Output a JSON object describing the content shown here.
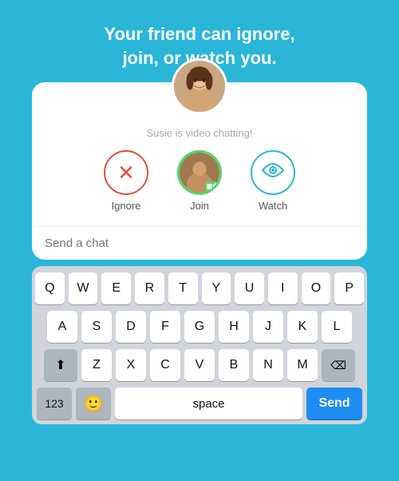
{
  "header": {
    "title": "Your friend can ignore,\njoin, or watch you."
  },
  "card": {
    "status_text": "Susie is video chatting!",
    "actions": [
      {
        "id": "ignore",
        "label": "Ignore"
      },
      {
        "id": "join",
        "label": "Join"
      },
      {
        "id": "watch",
        "label": "Watch"
      }
    ],
    "chat_placeholder": "Send a chat"
  },
  "keyboard": {
    "rows": [
      [
        "Q",
        "W",
        "E",
        "R",
        "T",
        "Y",
        "U",
        "I",
        "O",
        "P"
      ],
      [
        "A",
        "S",
        "D",
        "F",
        "G",
        "H",
        "J",
        "K",
        "L"
      ],
      [
        "Z",
        "X",
        "C",
        "V",
        "B",
        "N",
        "M"
      ]
    ],
    "bottom": {
      "num_label": "123",
      "space_label": "space",
      "send_label": "Send"
    }
  }
}
